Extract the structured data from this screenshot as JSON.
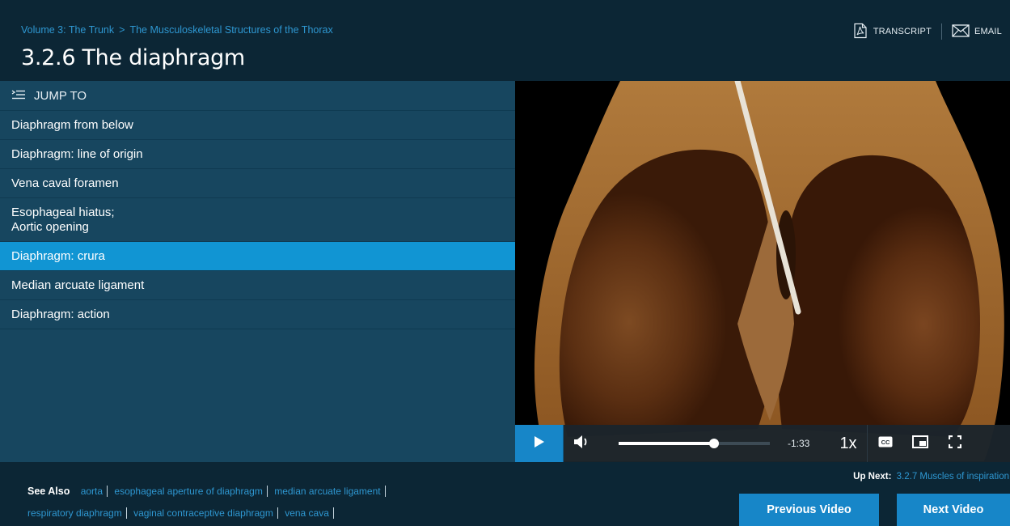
{
  "header": {
    "breadcrumb": [
      "Volume 3: The Trunk",
      "The Musculoskeletal Structures of the Thorax"
    ],
    "breadcrumb_sep": ">",
    "title": "3.2.6 The diaphragm",
    "transcript_label": "TRANSCRIPT",
    "email_label": "EMAIL"
  },
  "sidebar": {
    "jump_to_label": "JUMP TO",
    "chapters": [
      {
        "label": "Diaphragm from below"
      },
      {
        "label": "Diaphragm: line of origin"
      },
      {
        "label": "Vena caval foramen"
      },
      {
        "label": "Esophageal hiatus;",
        "label2": "Aortic opening"
      },
      {
        "label": "Diaphragm: crura",
        "active": true
      },
      {
        "label": "Median arcuate ligament"
      },
      {
        "label": "Diaphragm: action"
      }
    ]
  },
  "player": {
    "remaining_time": "-1:33",
    "playback_rate": "1x",
    "progress_fraction": 0.63,
    "accent_color": "#1786c8"
  },
  "footer": {
    "see_also_label": "See Also",
    "see_also_row1": [
      "aorta",
      "esophageal aperture of diaphragm",
      "median arcuate ligament"
    ],
    "see_also_row2": [
      "respiratory diaphragm",
      "vaginal contraceptive diaphragm",
      "vena cava"
    ],
    "up_next_label": "Up Next:",
    "up_next_title": "3.2.7 Muscles of inspiration",
    "previous_label": "Previous Video",
    "next_label": "Next Video"
  },
  "colors": {
    "background": "#0c2635",
    "sidebar": "#17465f",
    "active_item": "#1195d3",
    "link": "#2e97d1"
  },
  "icons": {
    "transcript": "pdf-icon",
    "email": "envelope-icon",
    "jump_to": "list-icon",
    "play": "play-icon",
    "volume": "volume-icon",
    "captions": "cc-icon",
    "pip": "picture-in-picture-icon",
    "fullscreen": "fullscreen-icon"
  }
}
